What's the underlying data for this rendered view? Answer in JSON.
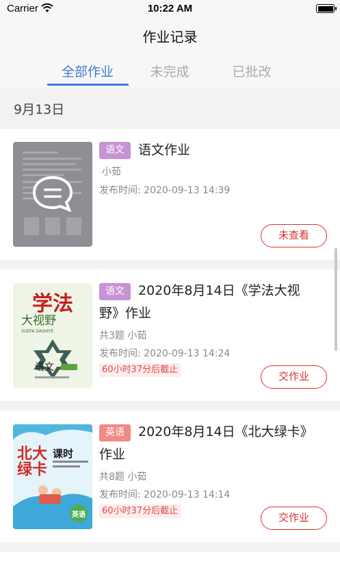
{
  "status_bar": {
    "carrier": "Carrier",
    "time": "10:22 AM"
  },
  "nav": {
    "title": "作业记录"
  },
  "tabs": [
    {
      "label": "全部作业",
      "active": true
    },
    {
      "label": "未完成",
      "active": false
    },
    {
      "label": "已批改",
      "active": false
    }
  ],
  "section": {
    "date": "9月13日"
  },
  "cards": [
    {
      "subject": "语文",
      "subject_color": "#c892d6",
      "title": "语文作业",
      "info": "小茹",
      "publish_time": "发布时间: 2020-09-13 14:39",
      "deadline": "",
      "action": "未查看",
      "thumb_icon": "document-chat-icon"
    },
    {
      "subject": "语文",
      "subject_color": "#c892d6",
      "title": "2020年8月14日《学法大视野》作业",
      "info": "共3题 小茹",
      "publish_time": "发布时间: 2020-09-13 14:24",
      "deadline": "60小时37分后截止",
      "action": "交作业",
      "thumb": {
        "line1": "学法",
        "line2": "大视野",
        "line3": "XUEFA DASHIYE",
        "line4": "语文"
      }
    },
    {
      "subject": "英语",
      "subject_color": "#f08a86",
      "title": "2020年8月14日《北大绿卡》作业",
      "info": "共8题 小茹",
      "publish_time": "发布时间: 2020-09-13 14:14",
      "deadline": "60小时37分后截止",
      "action": "交作业",
      "thumb": {
        "line1": "北大",
        "line2": "绿卡",
        "line3": "课时",
        "line4": "英语"
      }
    }
  ],
  "colors": {
    "accent": "#3a7bd5",
    "danger": "#d9322e",
    "tag_purple": "#c892d6",
    "tag_pink": "#f08a86"
  }
}
